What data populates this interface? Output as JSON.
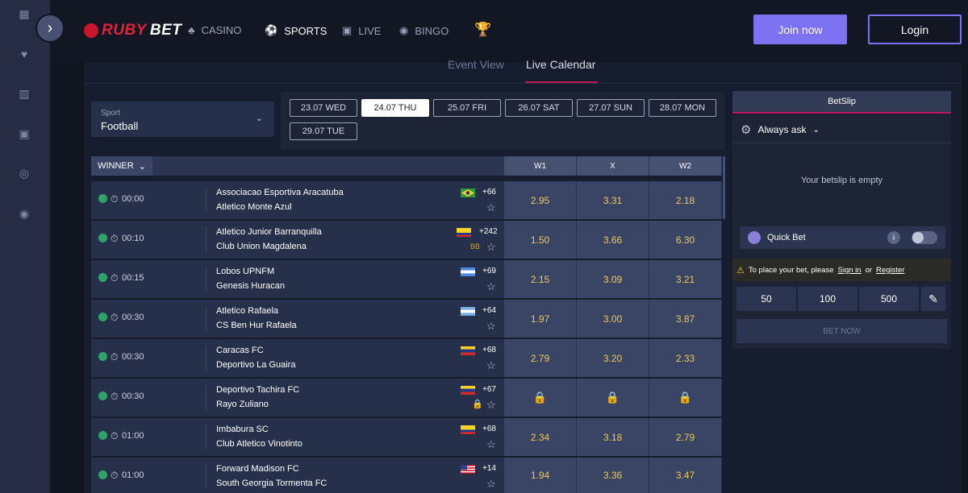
{
  "header": {
    "logo_text_ruby": "RUBY",
    "logo_text_bet": "BET",
    "nav": [
      {
        "label": "CASINO",
        "icon": "casino-icon"
      },
      {
        "label": "SPORTS",
        "icon": "sports-icon"
      },
      {
        "label": "LIVE",
        "icon": "live-icon"
      },
      {
        "label": "BINGO",
        "icon": "bingo-icon"
      }
    ],
    "join_label": "Join now",
    "login_label": "Login"
  },
  "tabs": [
    "Event View",
    "Live Calendar"
  ],
  "sport_select": {
    "label": "Sport",
    "value": "Football"
  },
  "dates": [
    "23.07 WED",
    "24.07 THU",
    "25.07 FRI",
    "26.07 SAT",
    "27.07 SUN",
    "28.07 MON",
    "29.07 TUE"
  ],
  "table": {
    "winner_label": "WINNER",
    "columns": [
      "W1",
      "X",
      "W2"
    ],
    "rows": [
      {
        "time": "00:00",
        "team1": "Associacao Esportiva Aracatuba",
        "team2": "Atletico Monte Azul",
        "count": "+66",
        "w1": "2.95",
        "x": "3.31",
        "w2": "2.18"
      },
      {
        "time": "00:10",
        "team1": "Atletico Junior Barranquilla",
        "team2": "Club Union Magdalena",
        "count": "+242",
        "extra": "BB",
        "w1": "1.50",
        "x": "3.66",
        "w2": "6.30"
      },
      {
        "time": "00:15",
        "team1": "Lobos UPNFM",
        "team2": "Genesis Huracan",
        "count": "+69",
        "w1": "2.15",
        "x": "3.09",
        "w2": "3.21"
      },
      {
        "time": "00:30",
        "team1": "Atletico Rafaela",
        "team2": "CS Ben Hur Rafaela",
        "count": "+64",
        "w1": "1.97",
        "x": "3.00",
        "w2": "3.87"
      },
      {
        "time": "00:30",
        "team1": "Caracas FC",
        "team2": "Deportivo La Guaira",
        "count": "+68",
        "w1": "2.79",
        "x": "3.20",
        "w2": "2.33"
      },
      {
        "time": "00:30",
        "team1": "Deportivo Tachira FC",
        "team2": "Rayo Zuliano",
        "count": "+67",
        "w1": "",
        "x": "",
        "w2": ""
      },
      {
        "time": "01:00",
        "team1": "Imbabura SC",
        "team2": "Club Atletico Vinotinto",
        "count": "+68",
        "w1": "2.34",
        "x": "3.18",
        "w2": "2.79"
      },
      {
        "time": "01:00",
        "team1": "Forward Madison FC",
        "team2": "South Georgia Tormenta FC",
        "count": "+14",
        "w1": "1.94",
        "x": "3.36",
        "w2": "3.47"
      }
    ]
  },
  "betslip": {
    "title": "BetSlip",
    "always_ask": "Always ask",
    "empty_text": "Your betslip is empty",
    "quick_bet": "Quick Bet",
    "warn_text": "To place your bet, please",
    "sign_in": "Sign in",
    "or": "or",
    "register": "Register",
    "stakes": [
      "50",
      "100",
      "500"
    ],
    "bet_now": "BET NOW"
  }
}
